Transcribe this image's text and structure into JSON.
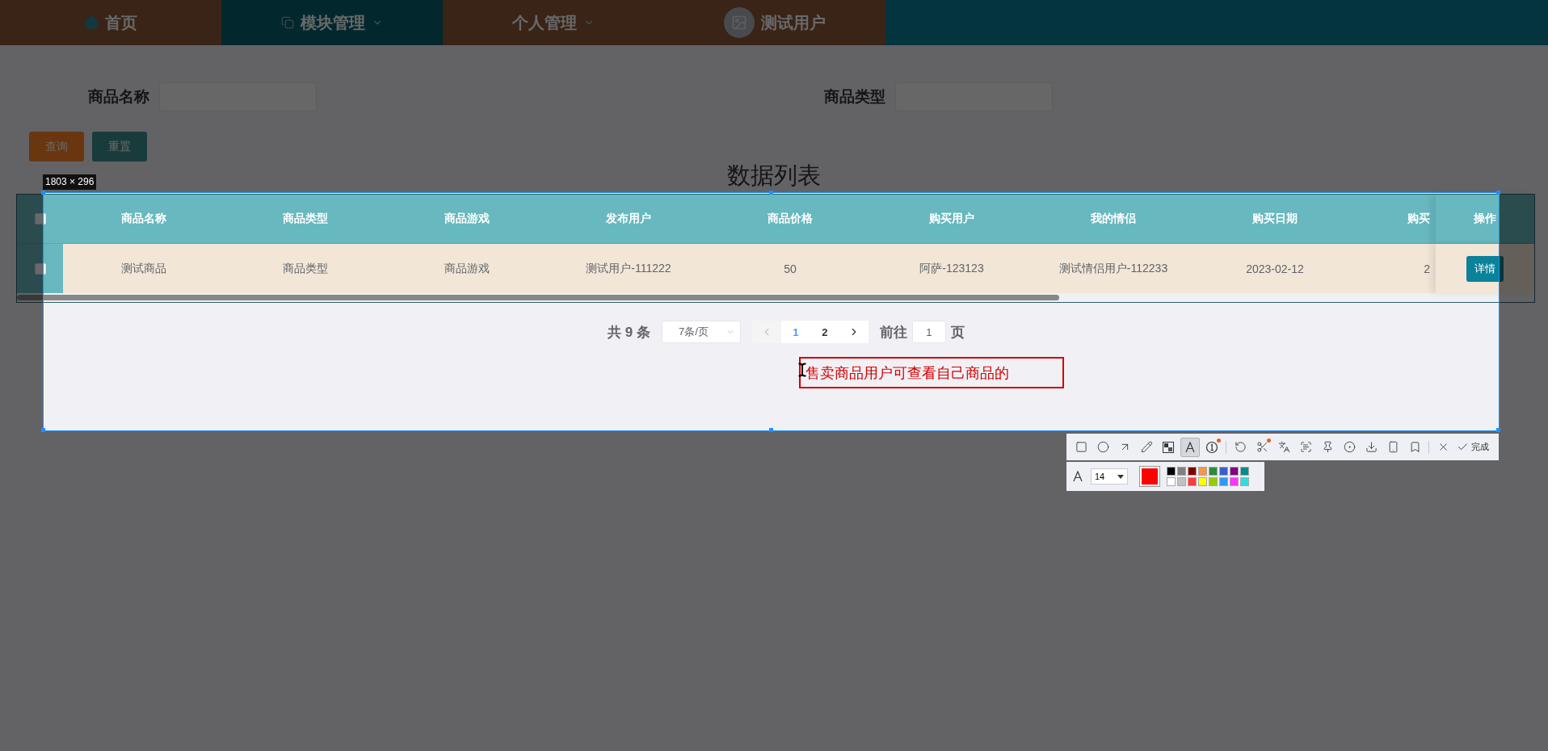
{
  "nav": {
    "items": [
      {
        "kind": "home",
        "label": "首页",
        "selected": false,
        "caret": false
      },
      {
        "kind": "module",
        "label": "模块管理",
        "selected": true,
        "caret": true
      },
      {
        "kind": "plain",
        "label": "个人管理",
        "selected": false,
        "caret": true
      },
      {
        "kind": "user",
        "label": "测试用户",
        "selected": false,
        "caret": false
      }
    ]
  },
  "search": {
    "fields": [
      {
        "label": "商品名称"
      },
      {
        "label": "商品类型"
      }
    ],
    "buttons": [
      {
        "kind": "primary",
        "label": "查询"
      },
      {
        "kind": "secondary",
        "label": "重置"
      }
    ]
  },
  "title": "数据列表",
  "table": {
    "columns": [
      "商品名称",
      "商品类型",
      "商品游戏",
      "发布用户",
      "商品价格",
      "购买用户",
      "我的情侣",
      "购买日期",
      "购买"
    ],
    "action_column": "操作",
    "header_checked": false,
    "rows": [
      {
        "checked": false,
        "cells": [
          "测试商品",
          "商品类型",
          "商品游戏",
          "测试用户-111222",
          "50",
          "阿萨-123123",
          "测试情侣用户-112233",
          "2023-02-12",
          "2"
        ],
        "action": "详情"
      }
    ]
  },
  "pagination": {
    "total": "共 9 条",
    "page_size": "7条/页",
    "pages": [
      {
        "label": "1",
        "selected": true
      },
      {
        "label": "2",
        "selected": false
      }
    ],
    "goto": "前往",
    "goto_value": "1",
    "page_unit": "页"
  },
  "capture": {
    "size_label": "1803 × 296",
    "annotation": "售卖商品用户可查看自己商品的",
    "tools": [
      {
        "kind": "rectangle",
        "selected": false,
        "badge": false
      },
      {
        "kind": "ellipse",
        "selected": false,
        "badge": false
      },
      {
        "kind": "arrow",
        "selected": false,
        "badge": false
      },
      {
        "kind": "pencil",
        "selected": false,
        "badge": false
      },
      {
        "kind": "mosaic",
        "selected": false,
        "badge": false
      },
      {
        "kind": "text",
        "selected": true,
        "badge": false
      },
      {
        "kind": "number",
        "selected": false,
        "badge": true
      },
      {
        "kind": "divider"
      },
      {
        "kind": "undo",
        "selected": false,
        "badge": false
      },
      {
        "kind": "cut",
        "selected": false,
        "badge": true
      },
      {
        "kind": "translate",
        "selected": false,
        "badge": false
      },
      {
        "kind": "ocr",
        "selected": false,
        "badge": false
      },
      {
        "kind": "pin",
        "selected": false,
        "badge": false
      },
      {
        "kind": "record",
        "selected": false,
        "badge": false
      },
      {
        "kind": "download",
        "selected": false,
        "badge": false
      },
      {
        "kind": "phone",
        "selected": false,
        "badge": false
      },
      {
        "kind": "bookmark",
        "selected": false,
        "badge": false
      },
      {
        "kind": "divider"
      },
      {
        "kind": "close",
        "selected": false,
        "badge": false
      }
    ],
    "done_label": "完成",
    "font_size": "14",
    "current": {
      "color": "#ff0000"
    },
    "palette": [
      {
        "color": "#000000"
      },
      {
        "color": "#808080"
      },
      {
        "color": "#800000"
      },
      {
        "color": "#f79646"
      },
      {
        "color": "#2e8b3a"
      },
      {
        "color": "#3a5fcd"
      },
      {
        "color": "#800080"
      },
      {
        "color": "#008b8b"
      },
      {
        "color": "#ffffff"
      },
      {
        "color": "#c0c0c0"
      },
      {
        "color": "#ff3b3b"
      },
      {
        "color": "#ffff00"
      },
      {
        "color": "#99cc00"
      },
      {
        "color": "#3399ee"
      },
      {
        "color": "#ff33ff"
      },
      {
        "color": "#33dddd"
      }
    ]
  }
}
